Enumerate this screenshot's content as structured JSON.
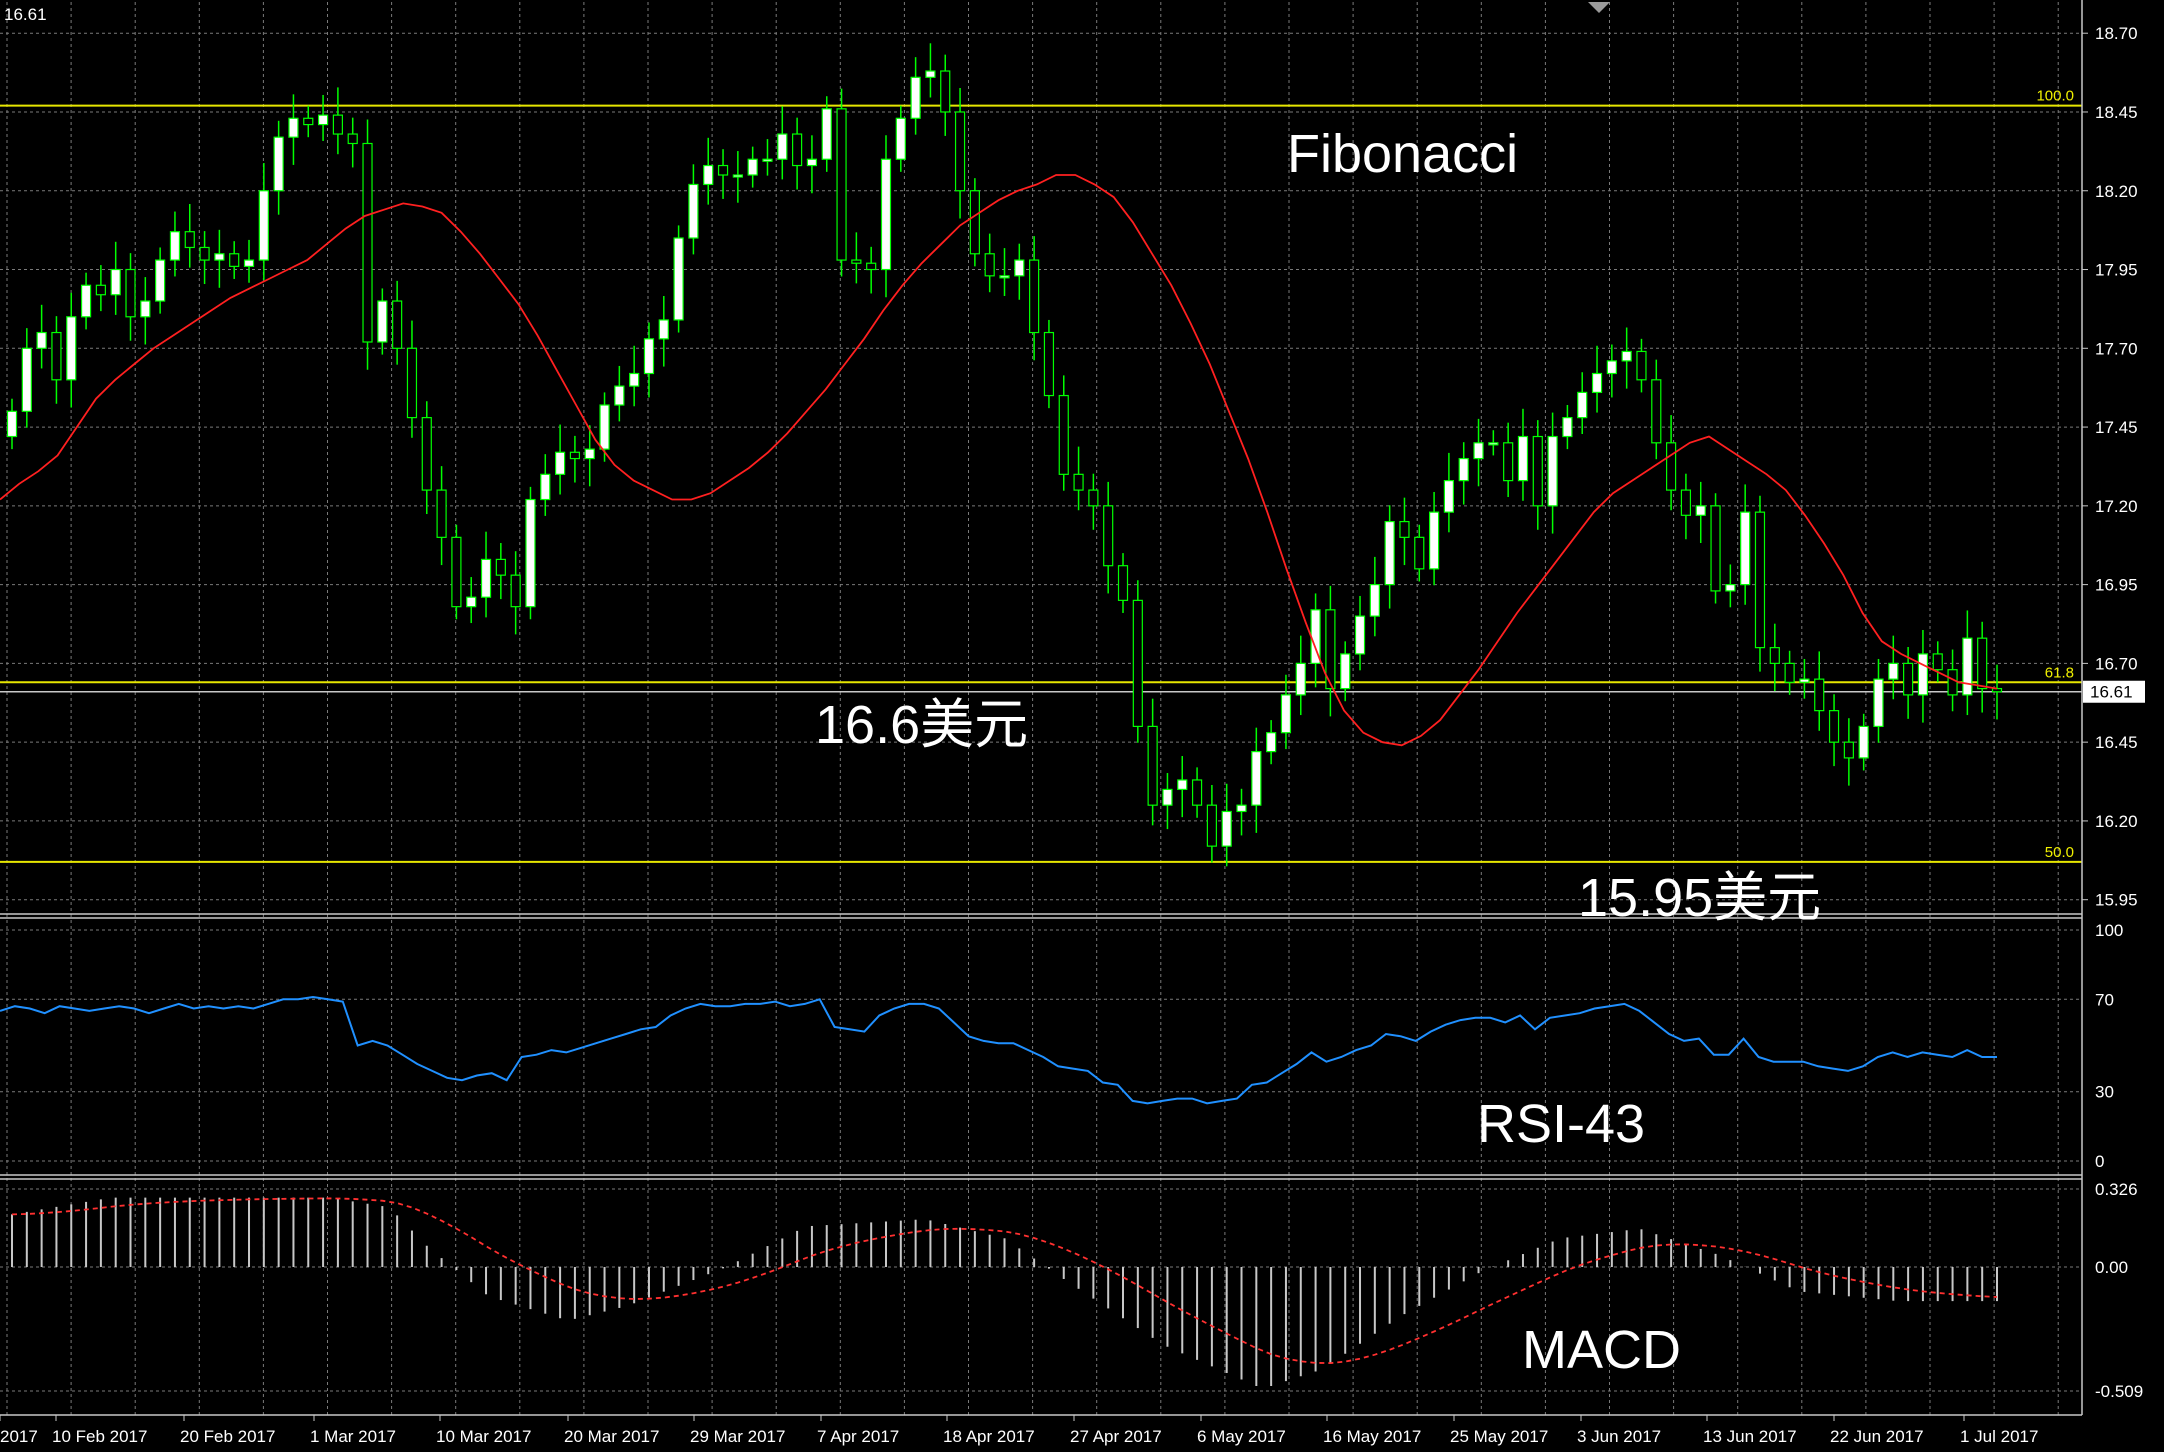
{
  "colors": {
    "background": "#000000",
    "grid": "#7a7a7a",
    "candle_up": "#ffffff",
    "candle_down": "#000000",
    "wick": "#00ff00",
    "moving_average": "#ff2020",
    "fibonacci_line": "#e6e600",
    "price_line": "#c8c8c8",
    "rsi": "#2090ff",
    "macd_histogram": "#c8c8c8",
    "macd_signal": "#ff3030",
    "text": "#ffffff"
  },
  "header": {
    "current_price": "16.61"
  },
  "annotations": {
    "fibonacci": "Fibonacci",
    "level_1_price": "16.6美元",
    "level_2_price": "15.95美元",
    "rsi_label": "RSI-43",
    "macd_label": "MACD"
  },
  "chart_data": [
    {
      "type": "candlestick",
      "panel": "price",
      "x_tick_labels": [
        "2017",
        "10 Feb 2017",
        "20 Feb 2017",
        "1 Mar 2017",
        "10 Mar 2017",
        "20 Mar 2017",
        "29 Mar 2017",
        "7 Apr 2017",
        "18 Apr 2017",
        "27 Apr 2017",
        "6 May 2017",
        "16 May 2017",
        "25 May 2017",
        "3 Jun 2017",
        "13 Jun 2017",
        "22 Jun 2017",
        "1 Jul 2017"
      ],
      "y_tick_labels": [
        "18.70",
        "18.45",
        "18.20",
        "17.95",
        "17.70",
        "17.45",
        "17.20",
        "16.95",
        "16.70",
        "16.45",
        "16.20",
        "15.95"
      ],
      "ylim": [
        15.93,
        18.78
      ],
      "current_price_label": "16.61",
      "fibonacci_levels": [
        {
          "label": "100.0",
          "price": 18.47
        },
        {
          "label": "61.8",
          "price": 16.64
        },
        {
          "label": "50.0",
          "price": 16.07
        }
      ],
      "close": [
        17.5,
        17.7,
        17.75,
        17.6,
        17.8,
        17.9,
        17.87,
        17.95,
        17.8,
        17.85,
        17.98,
        18.07,
        18.02,
        17.98,
        18.0,
        17.96,
        17.98,
        18.2,
        18.37,
        18.43,
        18.41,
        18.44,
        18.38,
        18.35,
        17.72,
        17.85,
        17.7,
        17.48,
        17.25,
        17.1,
        16.88,
        16.91,
        17.03,
        16.98,
        16.88,
        17.22,
        17.3,
        17.37,
        17.35,
        17.38,
        17.52,
        17.58,
        17.62,
        17.73,
        17.79,
        18.05,
        18.22,
        18.28,
        18.25,
        18.25,
        18.3,
        18.3,
        18.38,
        18.28,
        18.3,
        18.46,
        17.98,
        17.97,
        17.95,
        18.3,
        18.43,
        18.56,
        18.58,
        18.45,
        18.2,
        18.0,
        17.93,
        17.93,
        17.98,
        17.75,
        17.55,
        17.3,
        17.25,
        17.2,
        17.01,
        16.9,
        16.5,
        16.25,
        16.3,
        16.33,
        16.25,
        16.12,
        16.23,
        16.25,
        16.42,
        16.48,
        16.6,
        16.7,
        16.87,
        16.62,
        16.73,
        16.85,
        16.95,
        17.15,
        17.1,
        17.0,
        17.18,
        17.28,
        17.35,
        17.4,
        17.4,
        17.28,
        17.42,
        17.2,
        17.42,
        17.48,
        17.56,
        17.62,
        17.66,
        17.69,
        17.6,
        17.4,
        17.25,
        17.17,
        17.2,
        16.93,
        16.95,
        17.18,
        16.75,
        16.7,
        16.64,
        16.65,
        16.55,
        16.45,
        16.4,
        16.5,
        16.65,
        16.7,
        16.6,
        16.73,
        16.68,
        16.6,
        16.78,
        16.62,
        16.61
      ],
      "moving_average": [
        17.22,
        17.27,
        17.31,
        17.36,
        17.45,
        17.54,
        17.6,
        17.65,
        17.7,
        17.74,
        17.78,
        17.82,
        17.86,
        17.89,
        17.92,
        17.95,
        17.98,
        18.03,
        18.08,
        18.12,
        18.14,
        18.16,
        18.15,
        18.13,
        18.07,
        18.0,
        17.92,
        17.84,
        17.74,
        17.63,
        17.52,
        17.41,
        17.33,
        17.28,
        17.25,
        17.22,
        17.22,
        17.24,
        17.28,
        17.32,
        17.37,
        17.43,
        17.5,
        17.57,
        17.65,
        17.73,
        17.82,
        17.9,
        17.97,
        18.03,
        18.09,
        18.13,
        18.17,
        18.2,
        18.22,
        18.25,
        18.25,
        18.22,
        18.18,
        18.1,
        18.0,
        17.9,
        17.78,
        17.65,
        17.5,
        17.35,
        17.18,
        17.0,
        16.83,
        16.67,
        16.55,
        16.48,
        16.45,
        16.44,
        16.47,
        16.52,
        16.6,
        16.68,
        16.77,
        16.86,
        16.94,
        17.02,
        17.1,
        17.18,
        17.24,
        17.28,
        17.32,
        17.36,
        17.4,
        17.42,
        17.38,
        17.34,
        17.3,
        17.25,
        17.17,
        17.08,
        16.98,
        16.86,
        16.77,
        16.73,
        16.7,
        16.67,
        16.64,
        16.63,
        16.62
      ],
      "note_ma": "moving average values are listed for the visible portion starting at the first candle"
    },
    {
      "type": "line",
      "panel": "rsi",
      "name": "RSI-43",
      "y_tick_labels": [
        "100",
        "70",
        "30",
        "0"
      ],
      "ylim": [
        0,
        100
      ],
      "values": [
        65,
        67,
        66,
        64,
        67,
        66,
        65,
        66,
        67,
        66,
        64,
        66,
        68,
        66,
        67,
        66,
        67,
        66,
        68,
        70,
        70,
        71,
        70,
        69,
        50,
        52,
        50,
        46,
        42,
        39,
        36,
        35,
        37,
        38,
        35,
        45,
        46,
        48,
        47,
        49,
        51,
        53,
        55,
        57,
        58,
        63,
        66,
        68,
        67,
        67,
        68,
        68,
        69,
        67,
        68,
        70,
        58,
        57,
        56,
        63,
        66,
        68,
        68,
        66,
        60,
        54,
        52,
        51,
        51,
        48,
        45,
        41,
        40,
        39,
        34,
        33,
        26,
        25,
        26,
        27,
        27,
        25,
        26,
        27,
        33,
        34,
        38,
        42,
        47,
        43,
        45,
        48,
        50,
        55,
        54,
        52,
        56,
        59,
        61,
        62,
        62,
        60,
        63,
        57,
        62,
        63,
        64,
        66,
        67,
        68,
        65,
        60,
        55,
        52,
        53,
        46,
        46,
        53,
        45,
        43,
        43,
        43,
        41,
        40,
        39,
        41,
        45,
        47,
        45,
        47,
        46,
        45,
        48,
        45,
        45
      ]
    },
    {
      "type": "bar",
      "panel": "macd",
      "name": "MACD",
      "y_tick_labels": [
        "0.326",
        "0.00",
        "-0.509"
      ],
      "ylim": [
        -0.509,
        0.326
      ],
      "histogram_note": "histogram bars drawn from zero line, signal drawn as dashed red line"
    }
  ]
}
